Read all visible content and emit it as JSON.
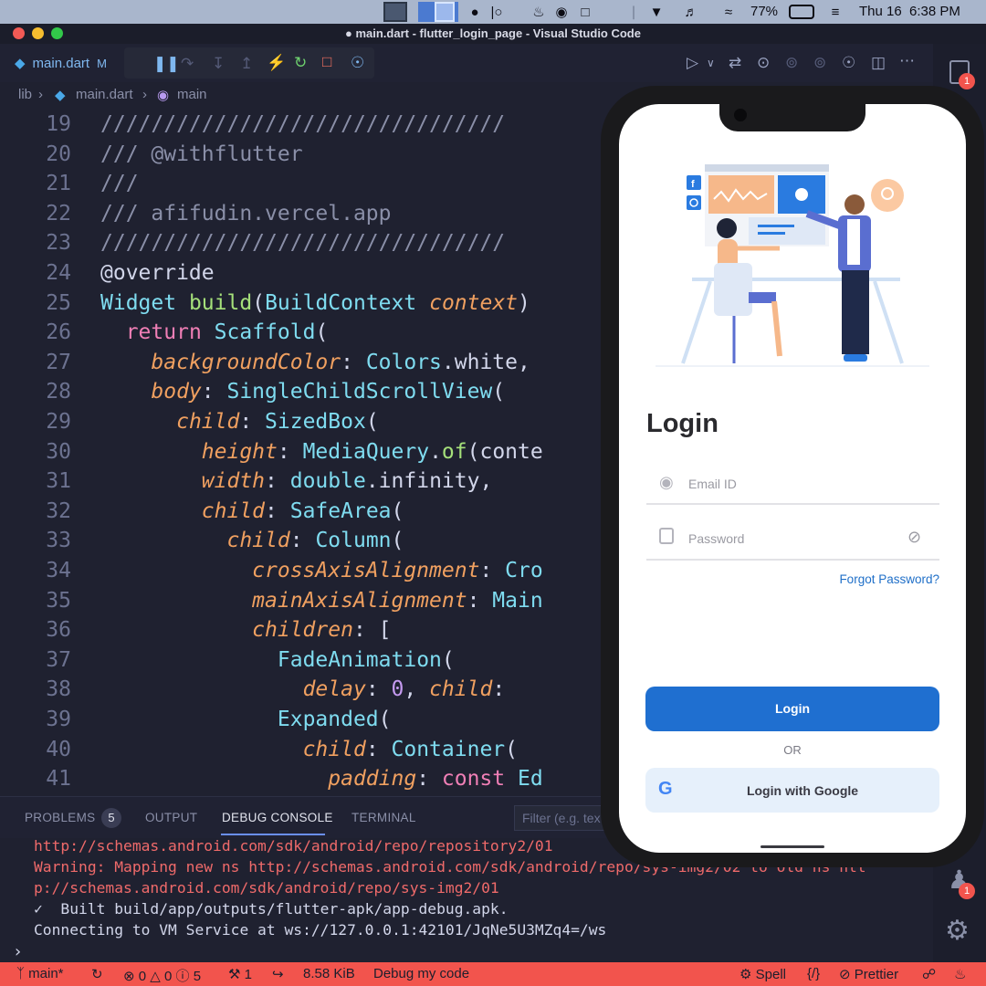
{
  "menubar": {
    "battery": "77%",
    "clock": "Thu 16  6:38 PM"
  },
  "window": {
    "title": "main.dart - flutter_login_page - Visual Studio Code"
  },
  "tab": {
    "label": "main.dart",
    "status": "M"
  },
  "breadcrumb": {
    "folder": "lib",
    "file": "main.dart",
    "symbol": "main"
  },
  "code_lines": [
    {
      "n": "19",
      "t": "////////////////////////////////"
    },
    {
      "n": "20",
      "t": "/// @withflutter"
    },
    {
      "n": "21",
      "t": "///"
    },
    {
      "n": "22",
      "t": "/// afifudin.vercel.app"
    },
    {
      "n": "23",
      "t": "////////////////////////////////"
    },
    {
      "n": "24",
      "t": "@override"
    },
    {
      "n": "25",
      "t": "Widget build(BuildContext context)"
    },
    {
      "n": "26",
      "t": "  return Scaffold("
    },
    {
      "n": "27",
      "t": "    backgroundColor: Colors.white,"
    },
    {
      "n": "28",
      "t": "    body: SingleChildScrollView("
    },
    {
      "n": "29",
      "t": "      child: SizedBox("
    },
    {
      "n": "30",
      "t": "        height: MediaQuery.of(conte"
    },
    {
      "n": "31",
      "t": "        width: double.infinity,"
    },
    {
      "n": "32",
      "t": "        child: SafeArea("
    },
    {
      "n": "33",
      "t": "          child: Column("
    },
    {
      "n": "34",
      "t": "            crossAxisAlignment: Cro"
    },
    {
      "n": "35",
      "t": "            mainAxisAlignment: Main"
    },
    {
      "n": "36",
      "t": "            children: ["
    },
    {
      "n": "37",
      "t": "              FadeAnimation("
    },
    {
      "n": "38",
      "t": "                delay: 0, child:"
    },
    {
      "n": "39",
      "t": "              Expanded("
    },
    {
      "n": "40",
      "t": "                child: Container("
    },
    {
      "n": "41",
      "t": "                  padding: const Ed"
    }
  ],
  "panel": {
    "tabs": [
      "PROBLEMS",
      "OUTPUT",
      "DEBUG CONSOLE",
      "TERMINAL"
    ],
    "problems_count": "5",
    "filter_placeholder": "Filter (e.g. tex"
  },
  "console_lines": [
    {
      "t": "http://schemas.android.com/sdk/android/repo/repository2/01",
      "c": "red"
    },
    {
      "t": "Warning: Mapping new ns http://schemas.android.com/sdk/android/repo/sys-img2/02 to old ns htt",
      "c": "red"
    },
    {
      "t": "p://schemas.android.com/sdk/android/repo/sys-img2/01",
      "c": "red"
    },
    {
      "t": "✓  Built build/app/outputs/flutter-apk/app-debug.apk.",
      "c": "white"
    },
    {
      "t": "Connecting to VM Service at ws://127.0.0.1:42101/JqNe5U3MZq4=/ws",
      "c": "white"
    }
  ],
  "statusbar": {
    "branch": "main*",
    "errors": "0",
    "warnings": "0",
    "infos": "5",
    "tools": "1",
    "size": "8.58 KiB",
    "debug": "Debug my code",
    "spell": "Spell",
    "prettier": "Prettier"
  },
  "activity": {
    "explorer_badge": "1",
    "accounts_badge": "1"
  },
  "phone": {
    "title": "Login",
    "email_placeholder": "Email ID",
    "password_placeholder": "Password",
    "forgot": "Forgot Password?",
    "login_button": "Login",
    "or": "OR",
    "google_button": "Login with Google"
  },
  "colors": {
    "accent": "#1f6fd0",
    "statusbar": "#f2544d"
  }
}
